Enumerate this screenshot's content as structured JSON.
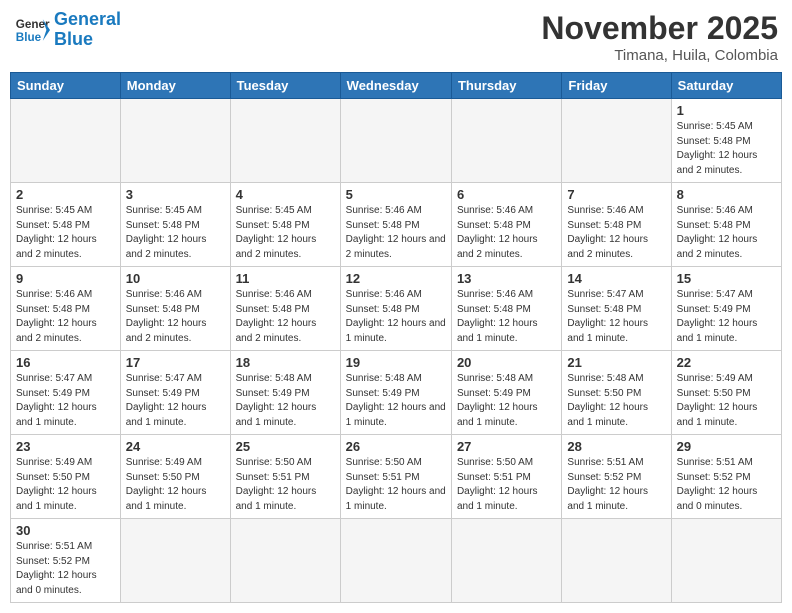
{
  "header": {
    "logo_general": "General",
    "logo_blue": "Blue",
    "month_title": "November 2025",
    "subtitle": "Timana, Huila, Colombia"
  },
  "days_of_week": [
    "Sunday",
    "Monday",
    "Tuesday",
    "Wednesday",
    "Thursday",
    "Friday",
    "Saturday"
  ],
  "weeks": [
    [
      {
        "day": "",
        "info": ""
      },
      {
        "day": "",
        "info": ""
      },
      {
        "day": "",
        "info": ""
      },
      {
        "day": "",
        "info": ""
      },
      {
        "day": "",
        "info": ""
      },
      {
        "day": "",
        "info": ""
      },
      {
        "day": "1",
        "info": "Sunrise: 5:45 AM\nSunset: 5:48 PM\nDaylight: 12 hours\nand 2 minutes."
      }
    ],
    [
      {
        "day": "2",
        "info": "Sunrise: 5:45 AM\nSunset: 5:48 PM\nDaylight: 12 hours\nand 2 minutes."
      },
      {
        "day": "3",
        "info": "Sunrise: 5:45 AM\nSunset: 5:48 PM\nDaylight: 12 hours\nand 2 minutes."
      },
      {
        "day": "4",
        "info": "Sunrise: 5:45 AM\nSunset: 5:48 PM\nDaylight: 12 hours\nand 2 minutes."
      },
      {
        "day": "5",
        "info": "Sunrise: 5:46 AM\nSunset: 5:48 PM\nDaylight: 12 hours\nand 2 minutes."
      },
      {
        "day": "6",
        "info": "Sunrise: 5:46 AM\nSunset: 5:48 PM\nDaylight: 12 hours\nand 2 minutes."
      },
      {
        "day": "7",
        "info": "Sunrise: 5:46 AM\nSunset: 5:48 PM\nDaylight: 12 hours\nand 2 minutes."
      },
      {
        "day": "8",
        "info": "Sunrise: 5:46 AM\nSunset: 5:48 PM\nDaylight: 12 hours\nand 2 minutes."
      }
    ],
    [
      {
        "day": "9",
        "info": "Sunrise: 5:46 AM\nSunset: 5:48 PM\nDaylight: 12 hours\nand 2 minutes."
      },
      {
        "day": "10",
        "info": "Sunrise: 5:46 AM\nSunset: 5:48 PM\nDaylight: 12 hours\nand 2 minutes."
      },
      {
        "day": "11",
        "info": "Sunrise: 5:46 AM\nSunset: 5:48 PM\nDaylight: 12 hours\nand 2 minutes."
      },
      {
        "day": "12",
        "info": "Sunrise: 5:46 AM\nSunset: 5:48 PM\nDaylight: 12 hours\nand 1 minute."
      },
      {
        "day": "13",
        "info": "Sunrise: 5:46 AM\nSunset: 5:48 PM\nDaylight: 12 hours\nand 1 minute."
      },
      {
        "day": "14",
        "info": "Sunrise: 5:47 AM\nSunset: 5:48 PM\nDaylight: 12 hours\nand 1 minute."
      },
      {
        "day": "15",
        "info": "Sunrise: 5:47 AM\nSunset: 5:49 PM\nDaylight: 12 hours\nand 1 minute."
      }
    ],
    [
      {
        "day": "16",
        "info": "Sunrise: 5:47 AM\nSunset: 5:49 PM\nDaylight: 12 hours\nand 1 minute."
      },
      {
        "day": "17",
        "info": "Sunrise: 5:47 AM\nSunset: 5:49 PM\nDaylight: 12 hours\nand 1 minute."
      },
      {
        "day": "18",
        "info": "Sunrise: 5:48 AM\nSunset: 5:49 PM\nDaylight: 12 hours\nand 1 minute."
      },
      {
        "day": "19",
        "info": "Sunrise: 5:48 AM\nSunset: 5:49 PM\nDaylight: 12 hours\nand 1 minute."
      },
      {
        "day": "20",
        "info": "Sunrise: 5:48 AM\nSunset: 5:49 PM\nDaylight: 12 hours\nand 1 minute."
      },
      {
        "day": "21",
        "info": "Sunrise: 5:48 AM\nSunset: 5:50 PM\nDaylight: 12 hours\nand 1 minute."
      },
      {
        "day": "22",
        "info": "Sunrise: 5:49 AM\nSunset: 5:50 PM\nDaylight: 12 hours\nand 1 minute."
      }
    ],
    [
      {
        "day": "23",
        "info": "Sunrise: 5:49 AM\nSunset: 5:50 PM\nDaylight: 12 hours\nand 1 minute."
      },
      {
        "day": "24",
        "info": "Sunrise: 5:49 AM\nSunset: 5:50 PM\nDaylight: 12 hours\nand 1 minute."
      },
      {
        "day": "25",
        "info": "Sunrise: 5:50 AM\nSunset: 5:51 PM\nDaylight: 12 hours\nand 1 minute."
      },
      {
        "day": "26",
        "info": "Sunrise: 5:50 AM\nSunset: 5:51 PM\nDaylight: 12 hours\nand 1 minute."
      },
      {
        "day": "27",
        "info": "Sunrise: 5:50 AM\nSunset: 5:51 PM\nDaylight: 12 hours\nand 1 minute."
      },
      {
        "day": "28",
        "info": "Sunrise: 5:51 AM\nSunset: 5:52 PM\nDaylight: 12 hours\nand 1 minute."
      },
      {
        "day": "29",
        "info": "Sunrise: 5:51 AM\nSunset: 5:52 PM\nDaylight: 12 hours\nand 0 minutes."
      }
    ],
    [
      {
        "day": "30",
        "info": "Sunrise: 5:51 AM\nSunset: 5:52 PM\nDaylight: 12 hours\nand 0 minutes."
      },
      {
        "day": "",
        "info": ""
      },
      {
        "day": "",
        "info": ""
      },
      {
        "day": "",
        "info": ""
      },
      {
        "day": "",
        "info": ""
      },
      {
        "day": "",
        "info": ""
      },
      {
        "day": "",
        "info": ""
      }
    ]
  ]
}
